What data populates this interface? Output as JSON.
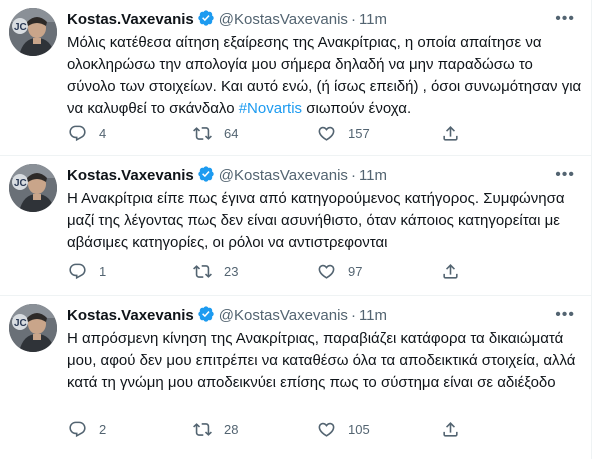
{
  "tweets": [
    {
      "name": "Kostas.Vaxevanis",
      "handle": "@KostasVaxevanis",
      "separator": "·",
      "time": "11m",
      "text_before": "Μόλις κατέθεσα αίτηση εξαίρεσης της Ανακρίτριας, η οποία απαίτησε να ολοκληρώσω την απολογία μου σήμερα δηλαδή  να μην παραδώσω το σύνολο των στοιχείων. Και αυτό ενώ, (ή ίσως επειδή) , όσοι συνωμότησαν για να καλυφθεί το σκάνδαλο ",
      "hashtag": "#Novartis",
      "text_after": " σιωπούν ένοχα.",
      "replies": "4",
      "retweets": "64",
      "likes": "157"
    },
    {
      "name": "Kostas.Vaxevanis",
      "handle": "@KostasVaxevanis",
      "separator": "·",
      "time": "11m",
      "text": "Η Ανακρίτρια είπε πως έγινα από κατηγορούμενος κατήγορος. Συμφώνησα μαζί της λέγοντας πως δεν είναι ασυνήθιστο, όταν κάποιος κατηγορείται με αβάσιμες κατηγορίες, οι ρόλοι να αντιστρεφονται",
      "replies": "1",
      "retweets": "23",
      "likes": "97"
    },
    {
      "name": "Kostas.Vaxevanis",
      "handle": "@KostasVaxevanis",
      "separator": "·",
      "time": "11m",
      "text": "Η απρόσμενη κίνηση της Ανακρίτριας, παραβιάζει κατάφορα τα δικαιώματά μου, αφού δεν μου επιτρέπει να καταθέσω όλα τα αποδεικτικά στοιχεία, αλλά κατά τη γνώμη μου αποδεικνύει επίσης πως το σύστημα είναι σε αδιέξοδο",
      "replies": "2",
      "retweets": "28",
      "likes": "105"
    }
  ],
  "icons": {
    "avatar": "avatar",
    "verified": "verified-badge-icon",
    "more": "more-icon",
    "reply": "reply-icon",
    "retweet": "retweet-icon",
    "like": "like-icon",
    "share": "share-icon"
  },
  "colors": {
    "accent": "#1d9bf0",
    "text": "#0f1419",
    "secondary": "#536471",
    "divider": "#eff3f4"
  }
}
